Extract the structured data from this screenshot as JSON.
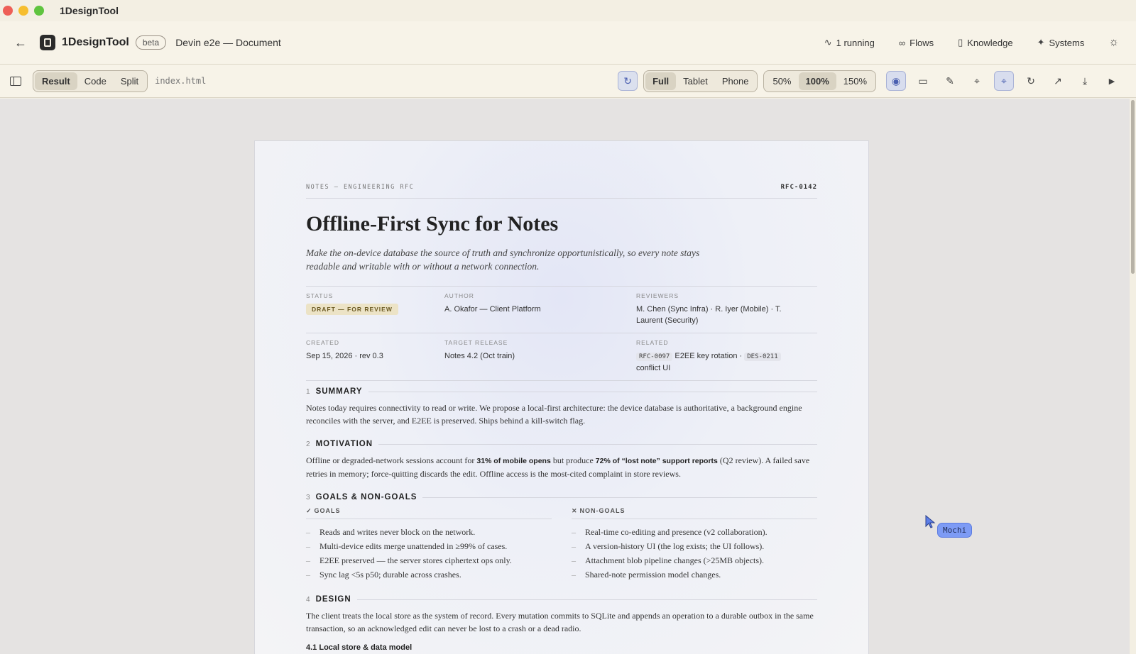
{
  "window": {
    "title": "1DesignTool"
  },
  "header": {
    "brand": "1DesignTool",
    "beta": "beta",
    "doc_title": "Devin e2e — Document",
    "nav": [
      {
        "label": "1 running",
        "icon": "activity-icon"
      },
      {
        "label": "Flows",
        "icon": "flows-icon"
      },
      {
        "label": "Knowledge",
        "icon": "book-icon"
      },
      {
        "label": "Systems",
        "icon": "sparkle-icon"
      }
    ]
  },
  "toolbar": {
    "views": [
      "Result",
      "Code",
      "Split"
    ],
    "active_view": "Result",
    "filename": "index.html",
    "devices": [
      "Full",
      "Tablet",
      "Phone"
    ],
    "active_device": "Full",
    "zooms": [
      "50%",
      "100%",
      "150%"
    ],
    "active_zoom": "100%"
  },
  "document": {
    "kicker": "NOTES — ENGINEERING RFC",
    "rfc_id": "RFC-0142",
    "title": "Offline-First Sync for Notes",
    "lede": "Make the on-device database the source of truth and synchronize opportunistically, so every note stays readable and writable with or without a network connection.",
    "meta": {
      "status_label": "STATUS",
      "status_value": "DRAFT — FOR REVIEW",
      "author_label": "AUTHOR",
      "author_value": "A. Okafor — Client Platform",
      "reviewers_label": "REVIEWERS",
      "reviewers_value": "M. Chen (Sync Infra) · R. Iyer (Mobile) · T. Laurent (Security)",
      "created_label": "CREATED",
      "created_value": "Sep 15, 2026 · rev 0.3",
      "target_label": "TARGET RELEASE",
      "target_value": "Notes 4.2 (Oct train)",
      "related_label": "RELATED",
      "related_code1": "RFC-0097",
      "related_text1": "E2EE key rotation ·",
      "related_code2": "DES-0211",
      "related_text2": "conflict UI"
    },
    "summary": {
      "num": "1",
      "title": "SUMMARY",
      "body": "Notes today requires connectivity to read or write. We propose a local-first architecture: the device database is authoritative, a background engine reconciles with the server, and E2EE is preserved. Ships behind a kill-switch flag."
    },
    "motivation": {
      "num": "2",
      "title": "MOTIVATION",
      "body_a": "Offline or degraded-network sessions account for ",
      "bold_a": "31% of mobile opens",
      "body_b": " but produce ",
      "bold_b": "72% of “lost note” support reports",
      "body_c": " (Q2 review). A failed save retries in memory; force-quitting discards the edit. Offline access is the most-cited complaint in store reviews."
    },
    "goals": {
      "num": "3",
      "title": "GOALS & NON-GOALS",
      "goals_label": "GOALS",
      "nongoals_label": "NON-GOALS",
      "goals": [
        "Reads and writes never block on the network.",
        "Multi-device edits merge unattended in ≥99% of cases.",
        "E2EE preserved — the server stores ciphertext ops only.",
        "Sync lag <5s p50; durable across crashes."
      ],
      "nongoals": [
        "Real-time co-editing and presence (v2 collaboration).",
        "A version-history UI (the log exists; the UI follows).",
        "Attachment blob pipeline changes (>25MB objects).",
        "Shared-note permission model changes."
      ]
    },
    "design": {
      "num": "4",
      "title": "DESIGN",
      "body": "The client treats the local store as the system of record. Every mutation commits to SQLite and appends an operation to a durable outbox in the same transaction, so an acknowledged edit can never be lost to a crash or a dead radio.",
      "subhead": "4.1  Local store & data model"
    }
  },
  "cursor": {
    "label": "Mochi"
  }
}
